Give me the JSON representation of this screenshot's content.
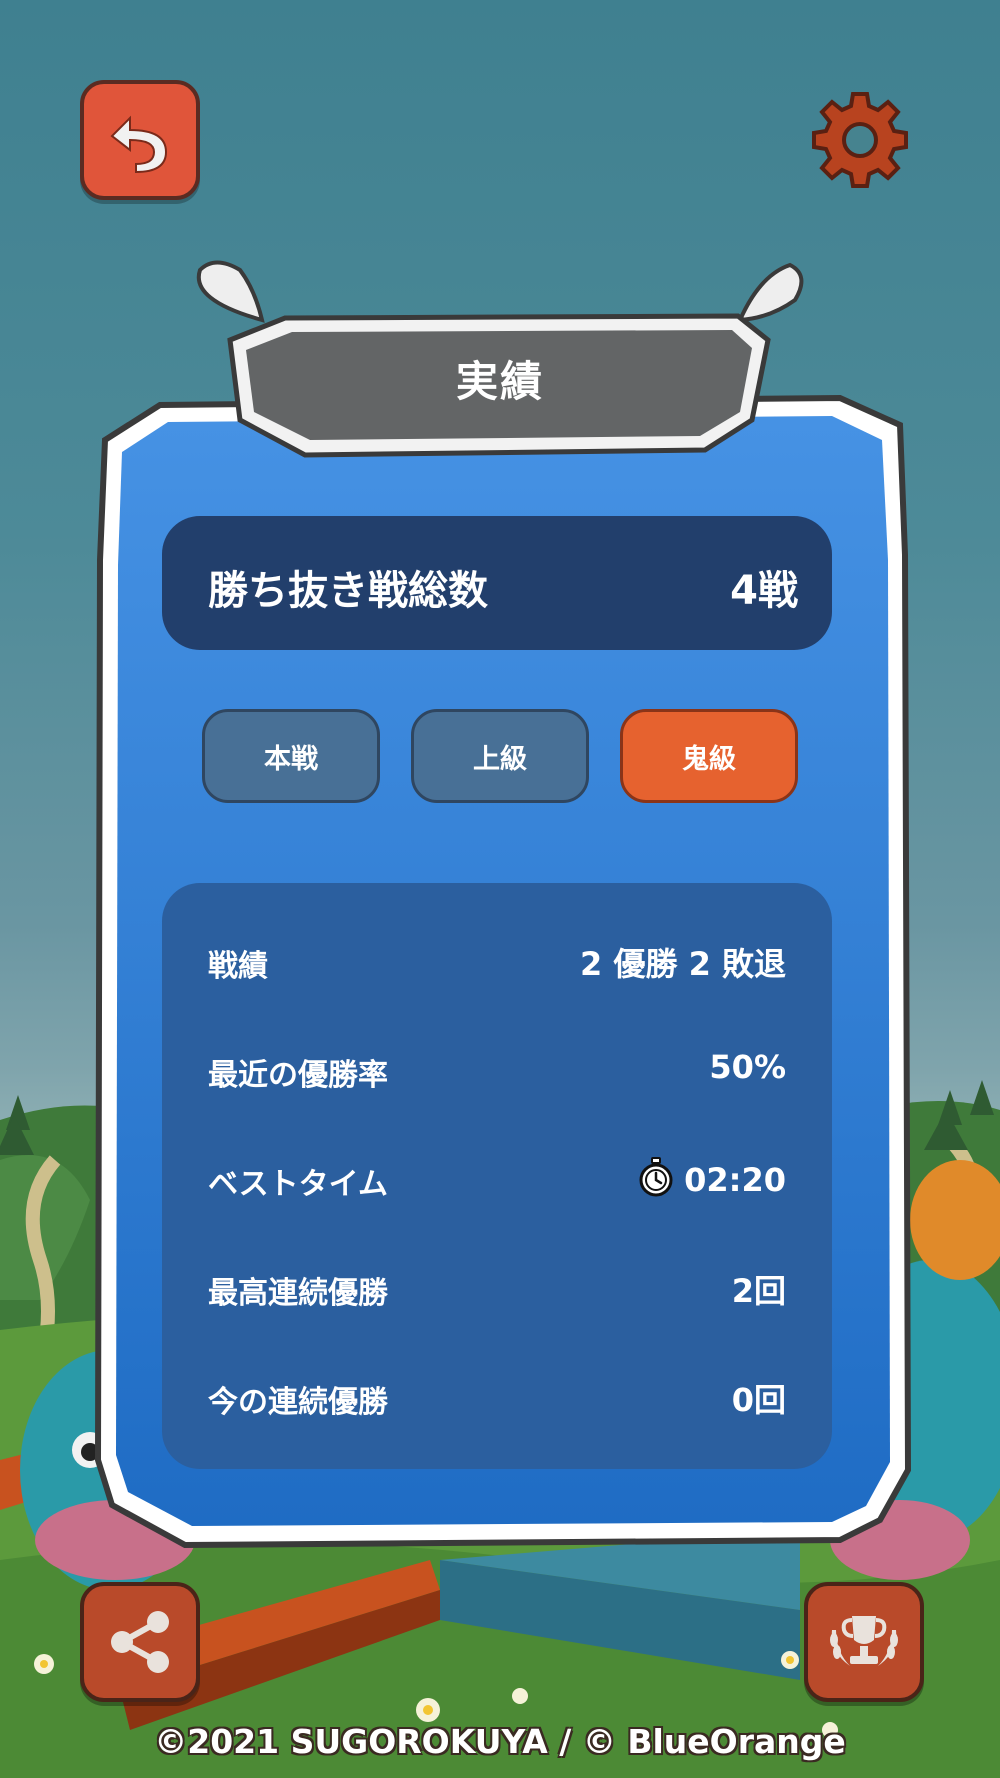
{
  "screen": {
    "title": "実績"
  },
  "summary": {
    "label": "勝ち抜き戦総数",
    "value": "4戦"
  },
  "tabs": [
    {
      "label": "本戦",
      "active": false
    },
    {
      "label": "上級",
      "active": false
    },
    {
      "label": "鬼級",
      "active": true
    }
  ],
  "stats": [
    {
      "label": "戦績",
      "value": "2 優勝 2 敗退"
    },
    {
      "label": "最近の優勝率",
      "value": "50%"
    },
    {
      "label": "ベストタイム",
      "value": "02:20",
      "icon": "stopwatch-icon"
    },
    {
      "label": "最高連続優勝",
      "value": "2回"
    },
    {
      "label": "今の連続優勝",
      "value": "0回"
    }
  ],
  "footer": {
    "copyright": "©2021 SUGOROKUYA / © BlueOrange"
  },
  "icons": {
    "back": "back-arrow-icon",
    "settings": "gear-icon",
    "share": "share-icon",
    "trophy": "trophy-icon"
  },
  "colors": {
    "accent": "#e6622f",
    "panel_dark": "#223f6c",
    "card_blue": "#3d8de0",
    "button_red": "#e0553a"
  }
}
